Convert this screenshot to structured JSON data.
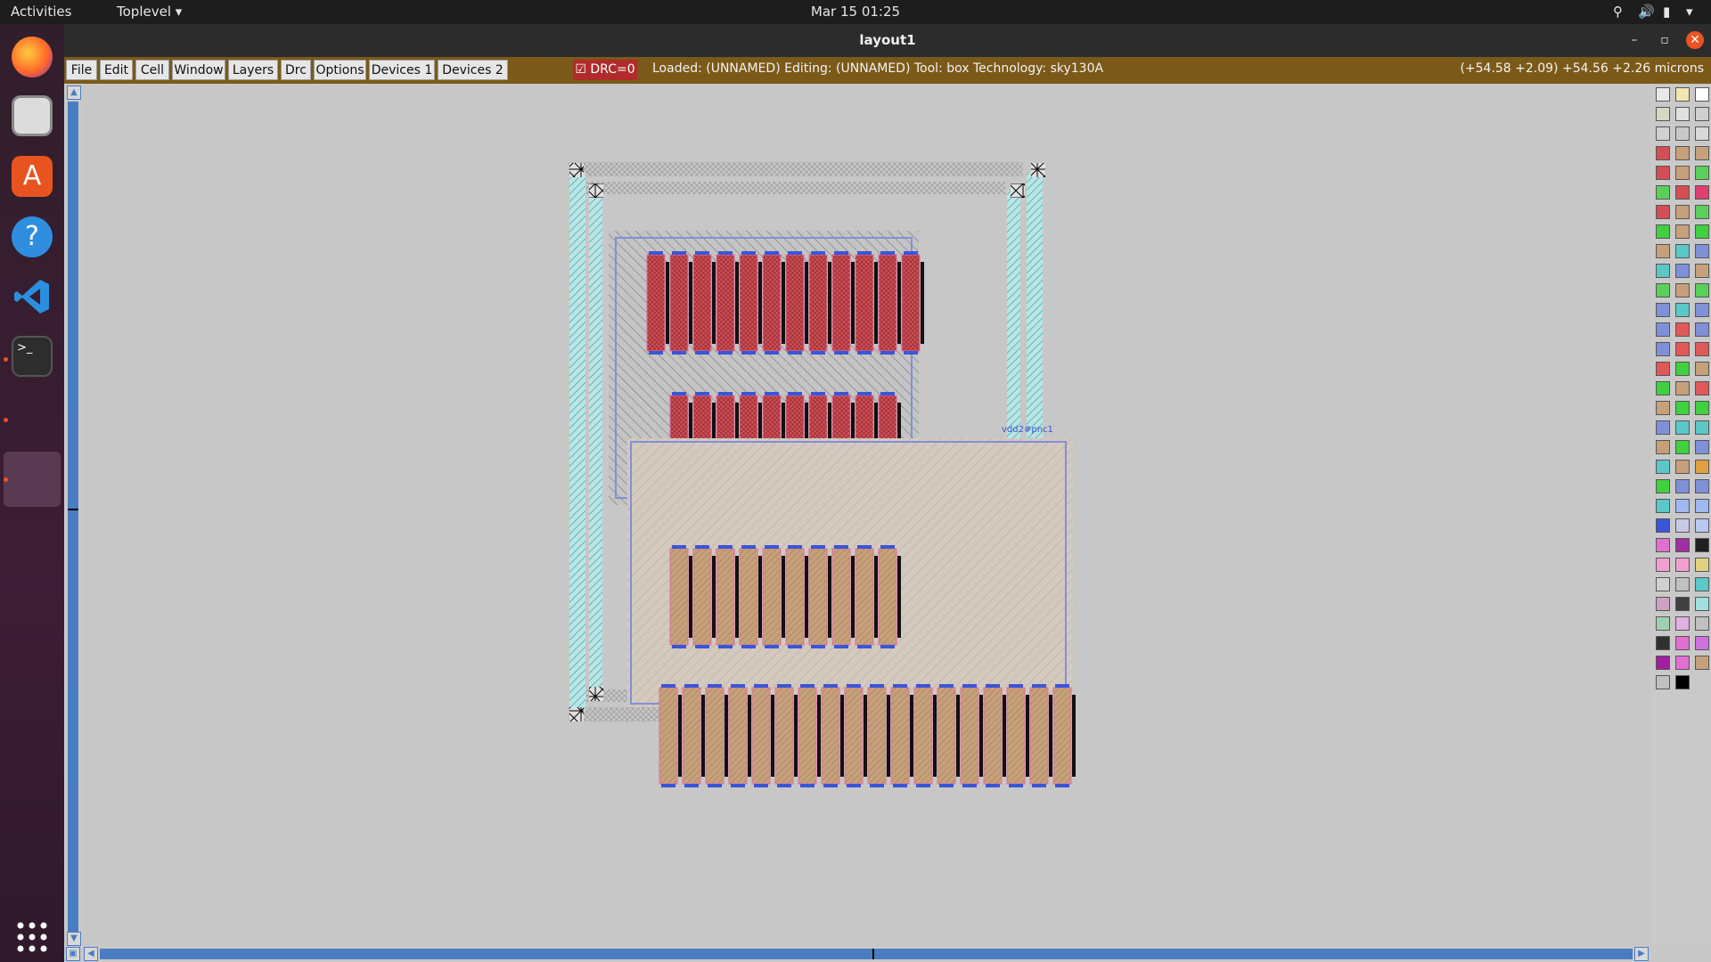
{
  "topbar": {
    "activities": "Activities",
    "app_menu": "Toplevel",
    "clock": "Mar 15  01:25"
  },
  "dock": {
    "apps": [
      "firefox-icon",
      "files-icon",
      "app-center-icon",
      "help-icon",
      "vscode-icon",
      "terminal-icon",
      "show-apps-icon"
    ]
  },
  "window": {
    "title": "layout1",
    "menus": [
      "File",
      "Edit",
      "Cell",
      "Window",
      "Layers",
      "Drc",
      "Options",
      "Devices 1",
      "Devices 2"
    ],
    "drc_label": "DRC=0",
    "status": "Loaded: (UNNAMED) Editing: (UNNAMED) Tool: box  Technology: sky130A",
    "coords": "(+54.58 +2.09) +54.56 +2.26 microns"
  },
  "layout": {
    "cell_label": "vdd2#pnc1",
    "colors": {
      "poly_red": "#d24f55",
      "diff_tan": "#c6a07a",
      "ring_teal": "#5bc7c7",
      "nwell": "#8090d8",
      "metal_blue": "#3a55d8"
    }
  }
}
